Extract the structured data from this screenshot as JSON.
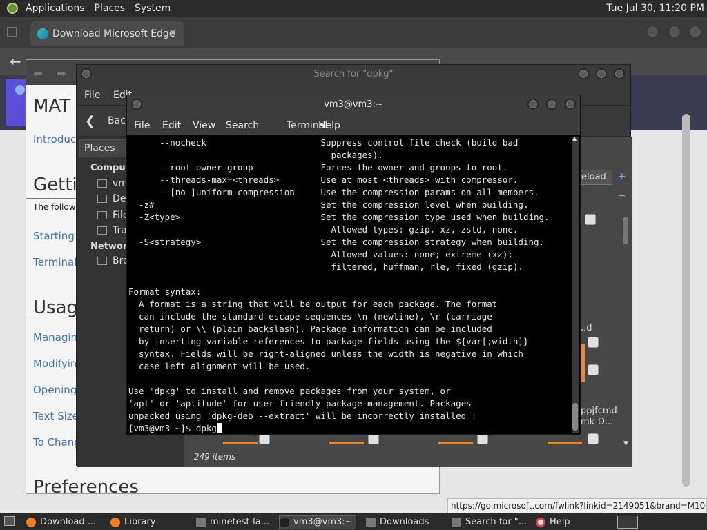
{
  "top_panel": {
    "menus": [
      "Applications",
      "Places",
      "System"
    ],
    "clock": "Tue Jul 30, 11:20 PM"
  },
  "browser": {
    "tab_title": "Download Microsoft Edge",
    "hover_url": "https://go.microsoft.com/fwlink?linkid=2149051&brand=M102"
  },
  "help_window": {
    "heading_partial": "MAT",
    "back_label": "Back",
    "links": [
      "Introduct",
      "Starting",
      "Terminal",
      "Managing",
      "Modifying",
      "Opening",
      "Text Size",
      "To Chang"
    ],
    "sections": [
      "Getting",
      "Usage",
      "Preferences"
    ],
    "intro_text": "The followi"
  },
  "search_window": {
    "title": "Search for \"dpkg\"",
    "menu_partial": [
      "File",
      "Edit"
    ],
    "places_header": "Places",
    "places_groups": [
      {
        "title": "Computer",
        "items": [
          "vm3",
          "Des",
          "File",
          "Tra"
        ]
      },
      {
        "title": "Network",
        "items": [
          "Bro"
        ]
      }
    ],
    "reload_label": "eload",
    "status": "249 items",
    "file_labels": [
      "..d",
      "ppjfcmd",
      "mk-D..."
    ]
  },
  "terminal": {
    "title": "vm3@vm3:~",
    "menus": [
      "File",
      "Edit",
      "View",
      "Search",
      "Terminal",
      "Help"
    ],
    "lines": [
      "      --nocheck                      Suppress control file check (build bad",
      "                                       packages).",
      "      --root-owner-group             Forces the owner and groups to root.",
      "      --threads-max=<threads>        Use at most <threads> with compressor.",
      "      --[no-]uniform-compression     Use the compression params on all members.",
      "  -z#                                Set the compression level when building.",
      "  -Z<type>                           Set the compression type used when building.",
      "                                       Allowed types: gzip, xz, zstd, none.",
      "  -S<strategy>                       Set the compression strategy when building.",
      "                                       Allowed values: none; extreme (xz);",
      "                                       filtered, huffman, rle, fixed (gzip).",
      "",
      "Format syntax:",
      "  A format is a string that will be output for each package. The format",
      "  can include the standard escape sequences \\n (newline), \\r (carriage",
      "  return) or \\\\ (plain backslash). Package information can be included",
      "  by inserting variable references to package fields using the ${var[;width]}",
      "  syntax. Fields will be right-aligned unless the width is negative in which",
      "  case left alignment will be used.",
      "",
      "Use 'dpkg' to install and remove packages from your system, or",
      "'apt' or 'aptitude' for user-friendly package management. Packages",
      "unpacked using 'dpkg-deb --extract' will be incorrectly installed !"
    ],
    "prompt": "[vm3@vm3 ~]$ dpkg"
  },
  "taskbar": {
    "items": [
      "Download ...",
      "Library",
      "minetest-la...",
      "vm3@vm3:~",
      "Downloads",
      "Search for \"...",
      "Help"
    ]
  }
}
